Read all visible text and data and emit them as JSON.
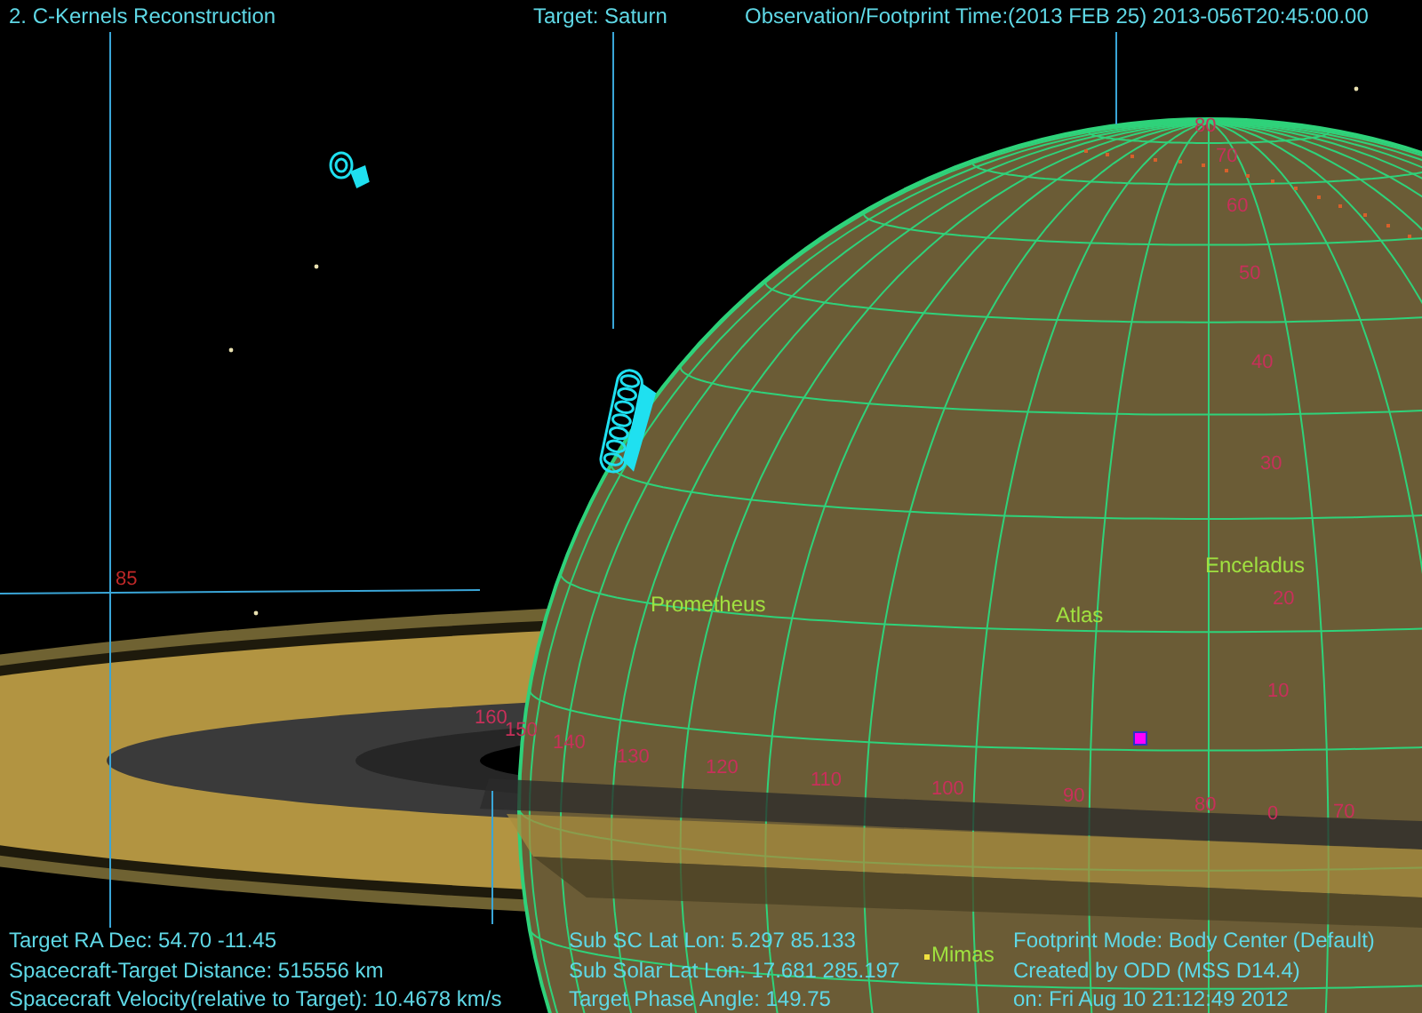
{
  "header": {
    "title": "2. C-Kernels Reconstruction",
    "target": "Target: Saturn",
    "time": "Observation/Footprint Time:(2013 FEB 25) 2013-056T20:45:00.00"
  },
  "info_left": [
    "Target RA Dec: 54.70  -11.45",
    "Spacecraft-Target Distance:  515556 km",
    "Spacecraft Velocity(relative to Target): 10.4678 km/s"
  ],
  "info_middle": [
    "Sub SC Lat Lon:  5.297  85.133",
    "Sub Solar Lat Lon: 17.681  285.197",
    "Target Phase Angle: 149.75"
  ],
  "info_right": [
    "Footprint Mode: Body Center (Default)",
    "Created by ODD (MSS D14.4)",
    "on: Fri Aug 10 21:12:49 2012"
  ],
  "moon_labels": [
    {
      "name": "Prometheus",
      "kind": "label"
    },
    {
      "name": "Atlas",
      "kind": "label"
    },
    {
      "name": "Enceladus",
      "kind": "label"
    },
    {
      "name": "Mimas",
      "kind": "point"
    }
  ],
  "latitude_labels": [
    "80",
    "70",
    "60",
    "50",
    "40",
    "30",
    "20",
    "10",
    "0"
  ],
  "longitude_labels": [
    "160",
    "150",
    "140",
    "130",
    "120",
    "110",
    "100",
    "90",
    "80",
    "70"
  ],
  "marker_label": "85"
}
